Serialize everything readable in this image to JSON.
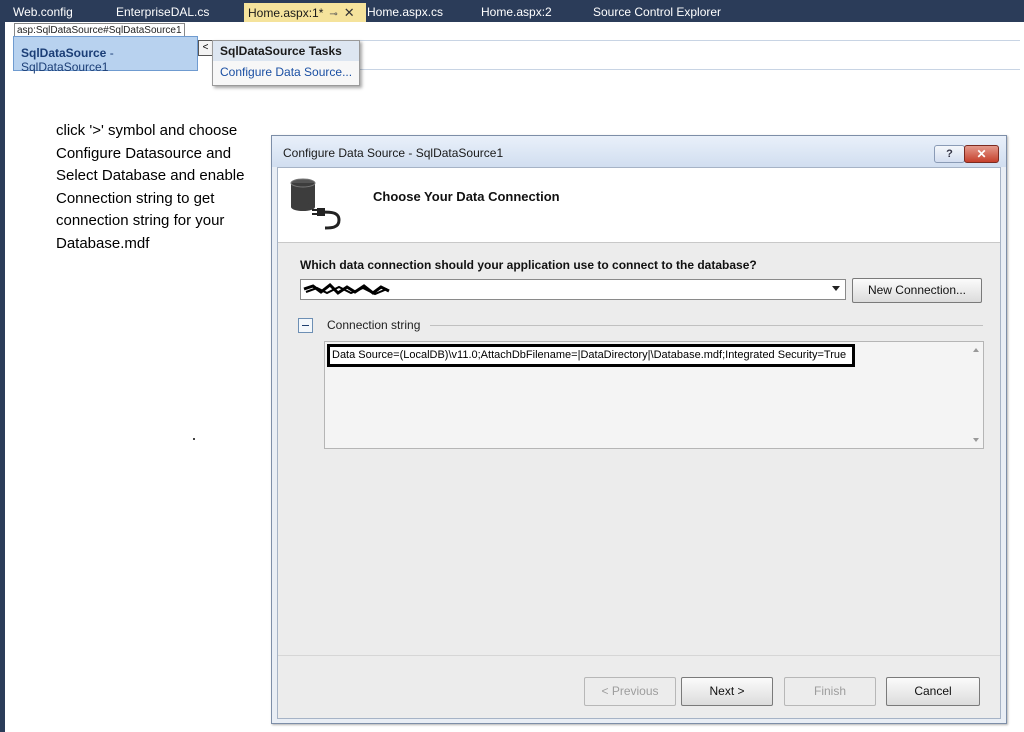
{
  "tabs": [
    {
      "label": "Web.config"
    },
    {
      "label": "EnterpriseDAL.cs"
    },
    {
      "label": "Home.aspx:1*"
    },
    {
      "label": "Home.aspx.cs"
    },
    {
      "label": "Home.aspx:2"
    },
    {
      "label": "Source Control Explorer"
    }
  ],
  "active_tab": "Home.aspx:1*",
  "designer": {
    "control_label": "asp:SqlDataSource#SqlDataSource1",
    "control_type": "SqlDataSource",
    "control_id": " - SqlDataSource1",
    "chevron": "<",
    "tasks_title": "SqlDataSource Tasks",
    "tasks_item": "Configure Data Source..."
  },
  "instruction": "click '>' symbol and choose Configure Datasource and Select Database and enable Connection string to get connection string for your Database.mdf",
  "dialog": {
    "title": "Configure Data Source - SqlDataSource1",
    "help_label": "?",
    "close_label": "✕",
    "header": "Choose Your Data Connection",
    "question": "Which data connection should your application use to connect to the database?",
    "new_connection_label": "New Connection...",
    "connection_string_label": "Connection string",
    "connection_string_value": "Data Source=(LocalDB)\\v11.0;AttachDbFilename=|DataDirectory|\\Database.mdf;Integrated Security=True",
    "buttons": {
      "previous": "< Previous",
      "next": "Next >",
      "finish": "Finish",
      "cancel": "Cancel"
    }
  },
  "colors": {
    "ide_frame": "#2b3c59",
    "active_tab": "#f5e39c",
    "selection": "#b8d2ef"
  }
}
